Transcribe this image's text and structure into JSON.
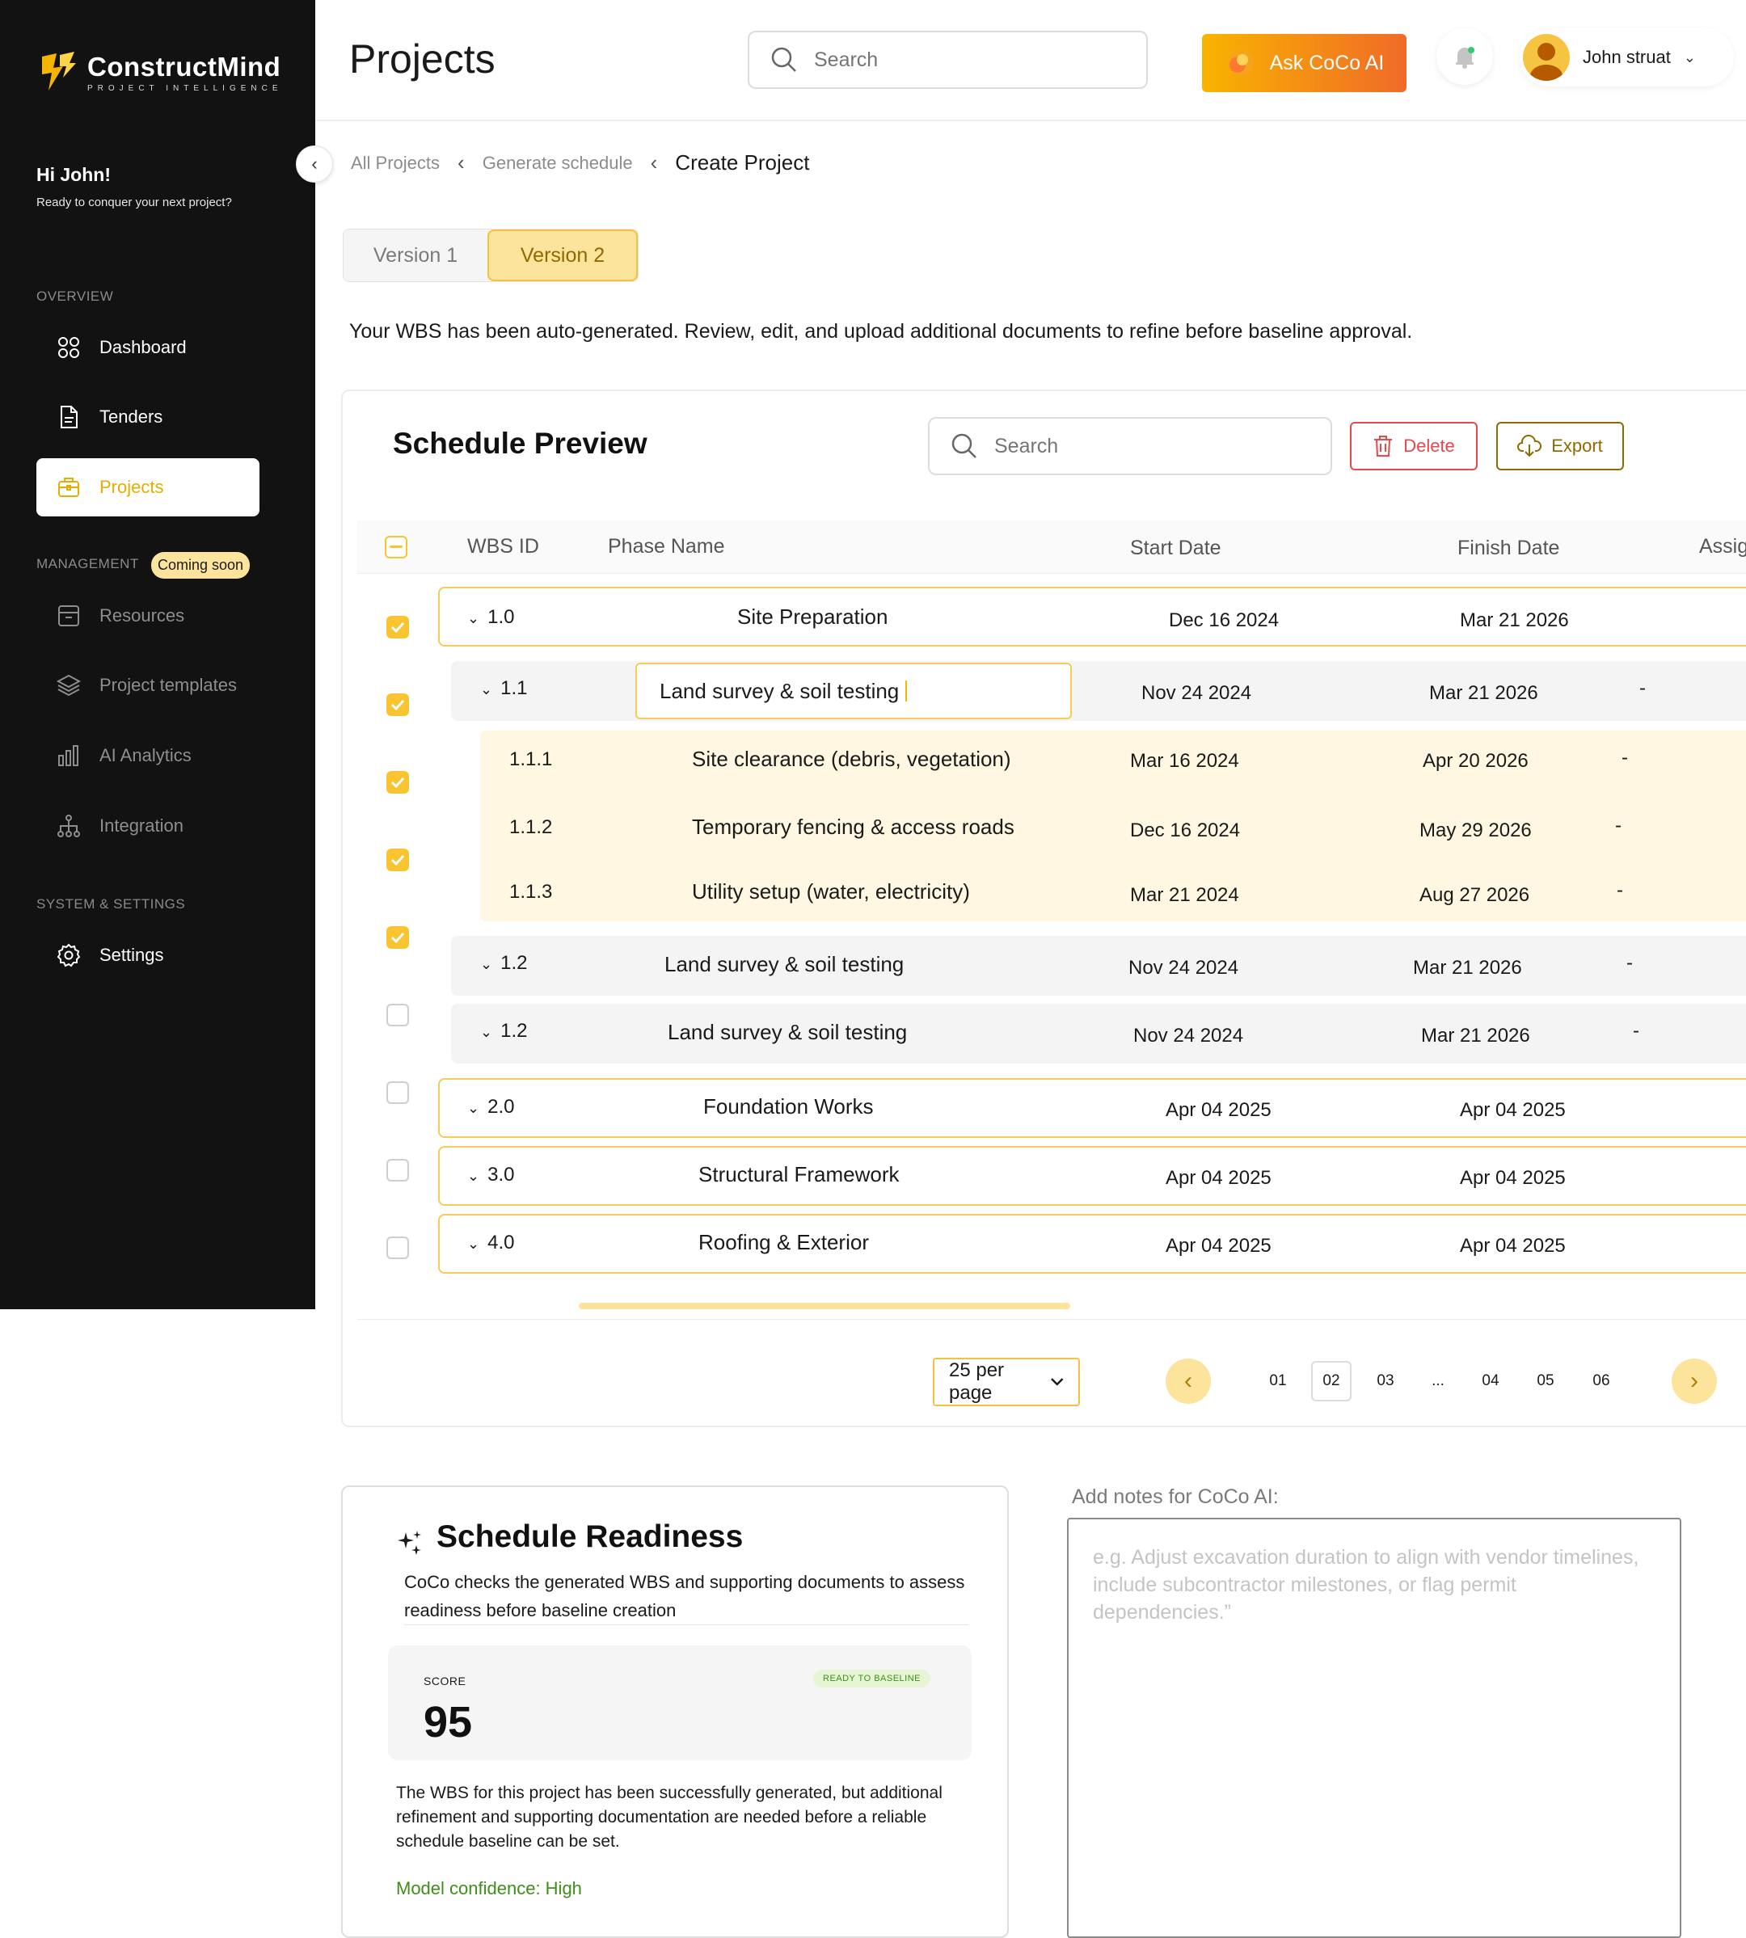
{
  "brand": {
    "name": "ConstructMind",
    "tagline": "PROJECT INTELLIGENCE",
    "accent": "#F8C531",
    "sidebar_bg": "#121212"
  },
  "sidebar": {
    "greeting": "Hi John!",
    "greeting_sub": "Ready to conquer your next project?",
    "overview_label": "OVERVIEW",
    "management_label": "MANAGEMENT",
    "coming_soon": "Coming soon",
    "system_label": "SYSTEM & SETTINGS",
    "items": {
      "dashboard": "Dashboard",
      "tenders": "Tenders",
      "projects": "Projects",
      "resources": "Resources",
      "templates": "Project templates",
      "analytics": "AI Analytics",
      "integration": "Integration",
      "settings": "Settings"
    }
  },
  "header": {
    "title": "Projects",
    "search_placeholder": "Search",
    "ask_label": "Ask CoCo AI",
    "user_name": "John struat"
  },
  "breadcrumb": {
    "all": "All Projects",
    "generate": "Generate schedule",
    "current": "Create Project"
  },
  "versions": {
    "v1": "Version 1",
    "v2": "Version 2",
    "active": "Version 2"
  },
  "intro": "Your WBS has been auto-generated. Review, edit, and upload additional documents to refine before baseline approval.",
  "preview": {
    "title": "Schedule Preview",
    "search_placeholder": "Search",
    "delete_label": "Delete",
    "export_label": "Export",
    "columns": {
      "wbs": "WBS ID",
      "phase": "Phase  Name",
      "start": "Start Date",
      "finish": "Finish Date",
      "assign": "Assig"
    },
    "rows": [
      {
        "id": "1.0",
        "name": "Site Preparation",
        "start": "Dec 16 2024",
        "finish": "Mar 21 2026",
        "assign": "",
        "checked": true
      },
      {
        "id": "1.1",
        "name": "Land survey & soil testing",
        "start": "Nov 24 2024",
        "finish": "Mar 21 2026",
        "assign": "-",
        "checked": true
      },
      {
        "id": "1.1.1",
        "name": "Site clearance (debris, vegetation)",
        "start": "Mar 16 2024",
        "finish": "Apr 20 2026",
        "assign": "-",
        "checked": true
      },
      {
        "id": "1.1.2",
        "name": "Temporary fencing & access roads",
        "start": "Dec 16 2024",
        "finish": "May 29 2026",
        "assign": "-",
        "checked": true
      },
      {
        "id": "1.1.3",
        "name": "Utility setup (water, electricity)",
        "start": "Mar 21 2024",
        "finish": "Aug 27 2026",
        "assign": "-",
        "checked": true
      },
      {
        "id": "1.2",
        "name": "Land survey & soil testing",
        "start": "Nov 24 2024",
        "finish": "Mar 21 2026",
        "assign": "-",
        "checked": false
      },
      {
        "id": "1.2",
        "name": "Land survey & soil testing",
        "start": "Nov 24 2024",
        "finish": "Mar 21 2026",
        "assign": "-",
        "checked": false
      },
      {
        "id": "2.0",
        "name": "Foundation Works",
        "start": "Apr 04 2025",
        "finish": "Apr 04 2025",
        "assign": "",
        "checked": false
      },
      {
        "id": "3.0",
        "name": "Structural Framework",
        "start": "Apr 04 2025",
        "finish": "Apr 04 2025",
        "assign": "",
        "checked": false
      },
      {
        "id": "4.0",
        "name": "Roofing & Exterior",
        "start": "Apr 04 2025",
        "finish": "Apr 04 2025",
        "assign": "",
        "checked": false
      }
    ]
  },
  "pagination": {
    "per_page": "25 per page",
    "pages": [
      "01",
      "02",
      "03",
      "...",
      "04",
      "05",
      "06"
    ],
    "current": "02"
  },
  "readiness": {
    "title": "Schedule Readiness",
    "desc": "CoCo checks the generated WBS and supporting documents to assess readiness before baseline creation",
    "score_label": "SCORE",
    "score": "95",
    "badge": "READY TO BASELINE",
    "body": "The WBS for this project has been successfully generated, but additional refinement and supporting documentation are needed before a reliable schedule baseline can be set.",
    "confidence": "Model confidence: High"
  },
  "notes": {
    "label": "Add notes for CoCo AI:",
    "placeholder": "e.g. Adjust excavation duration to align with vendor timelines, include subcontractor milestones, or flag permit dependencies.”"
  }
}
